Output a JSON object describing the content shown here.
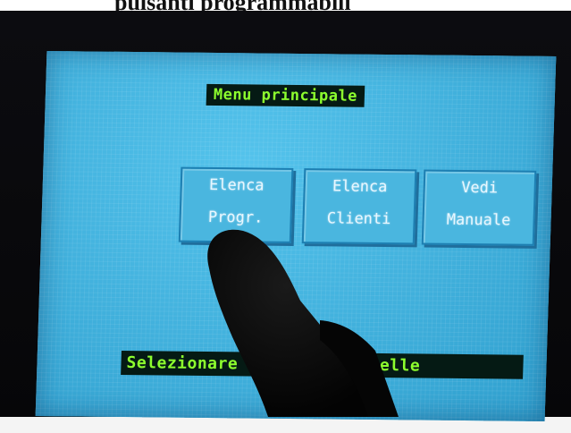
{
  "page_caption": "pulsanti programmabili",
  "screen": {
    "title": "Menu principale",
    "buttons": [
      {
        "line1": "Elenca",
        "line2": "Progr."
      },
      {
        "line1": "Elenca",
        "line2": "Clienti"
      },
      {
        "line1": "Vedi",
        "line2": "Manuale"
      }
    ],
    "status": "Selezionare una delle caselle"
  },
  "colors": {
    "screen_bg": "#3aaed8",
    "label_bg": "#051a14",
    "label_text": "#8dff2e",
    "button_border": "#1d7fb2"
  }
}
